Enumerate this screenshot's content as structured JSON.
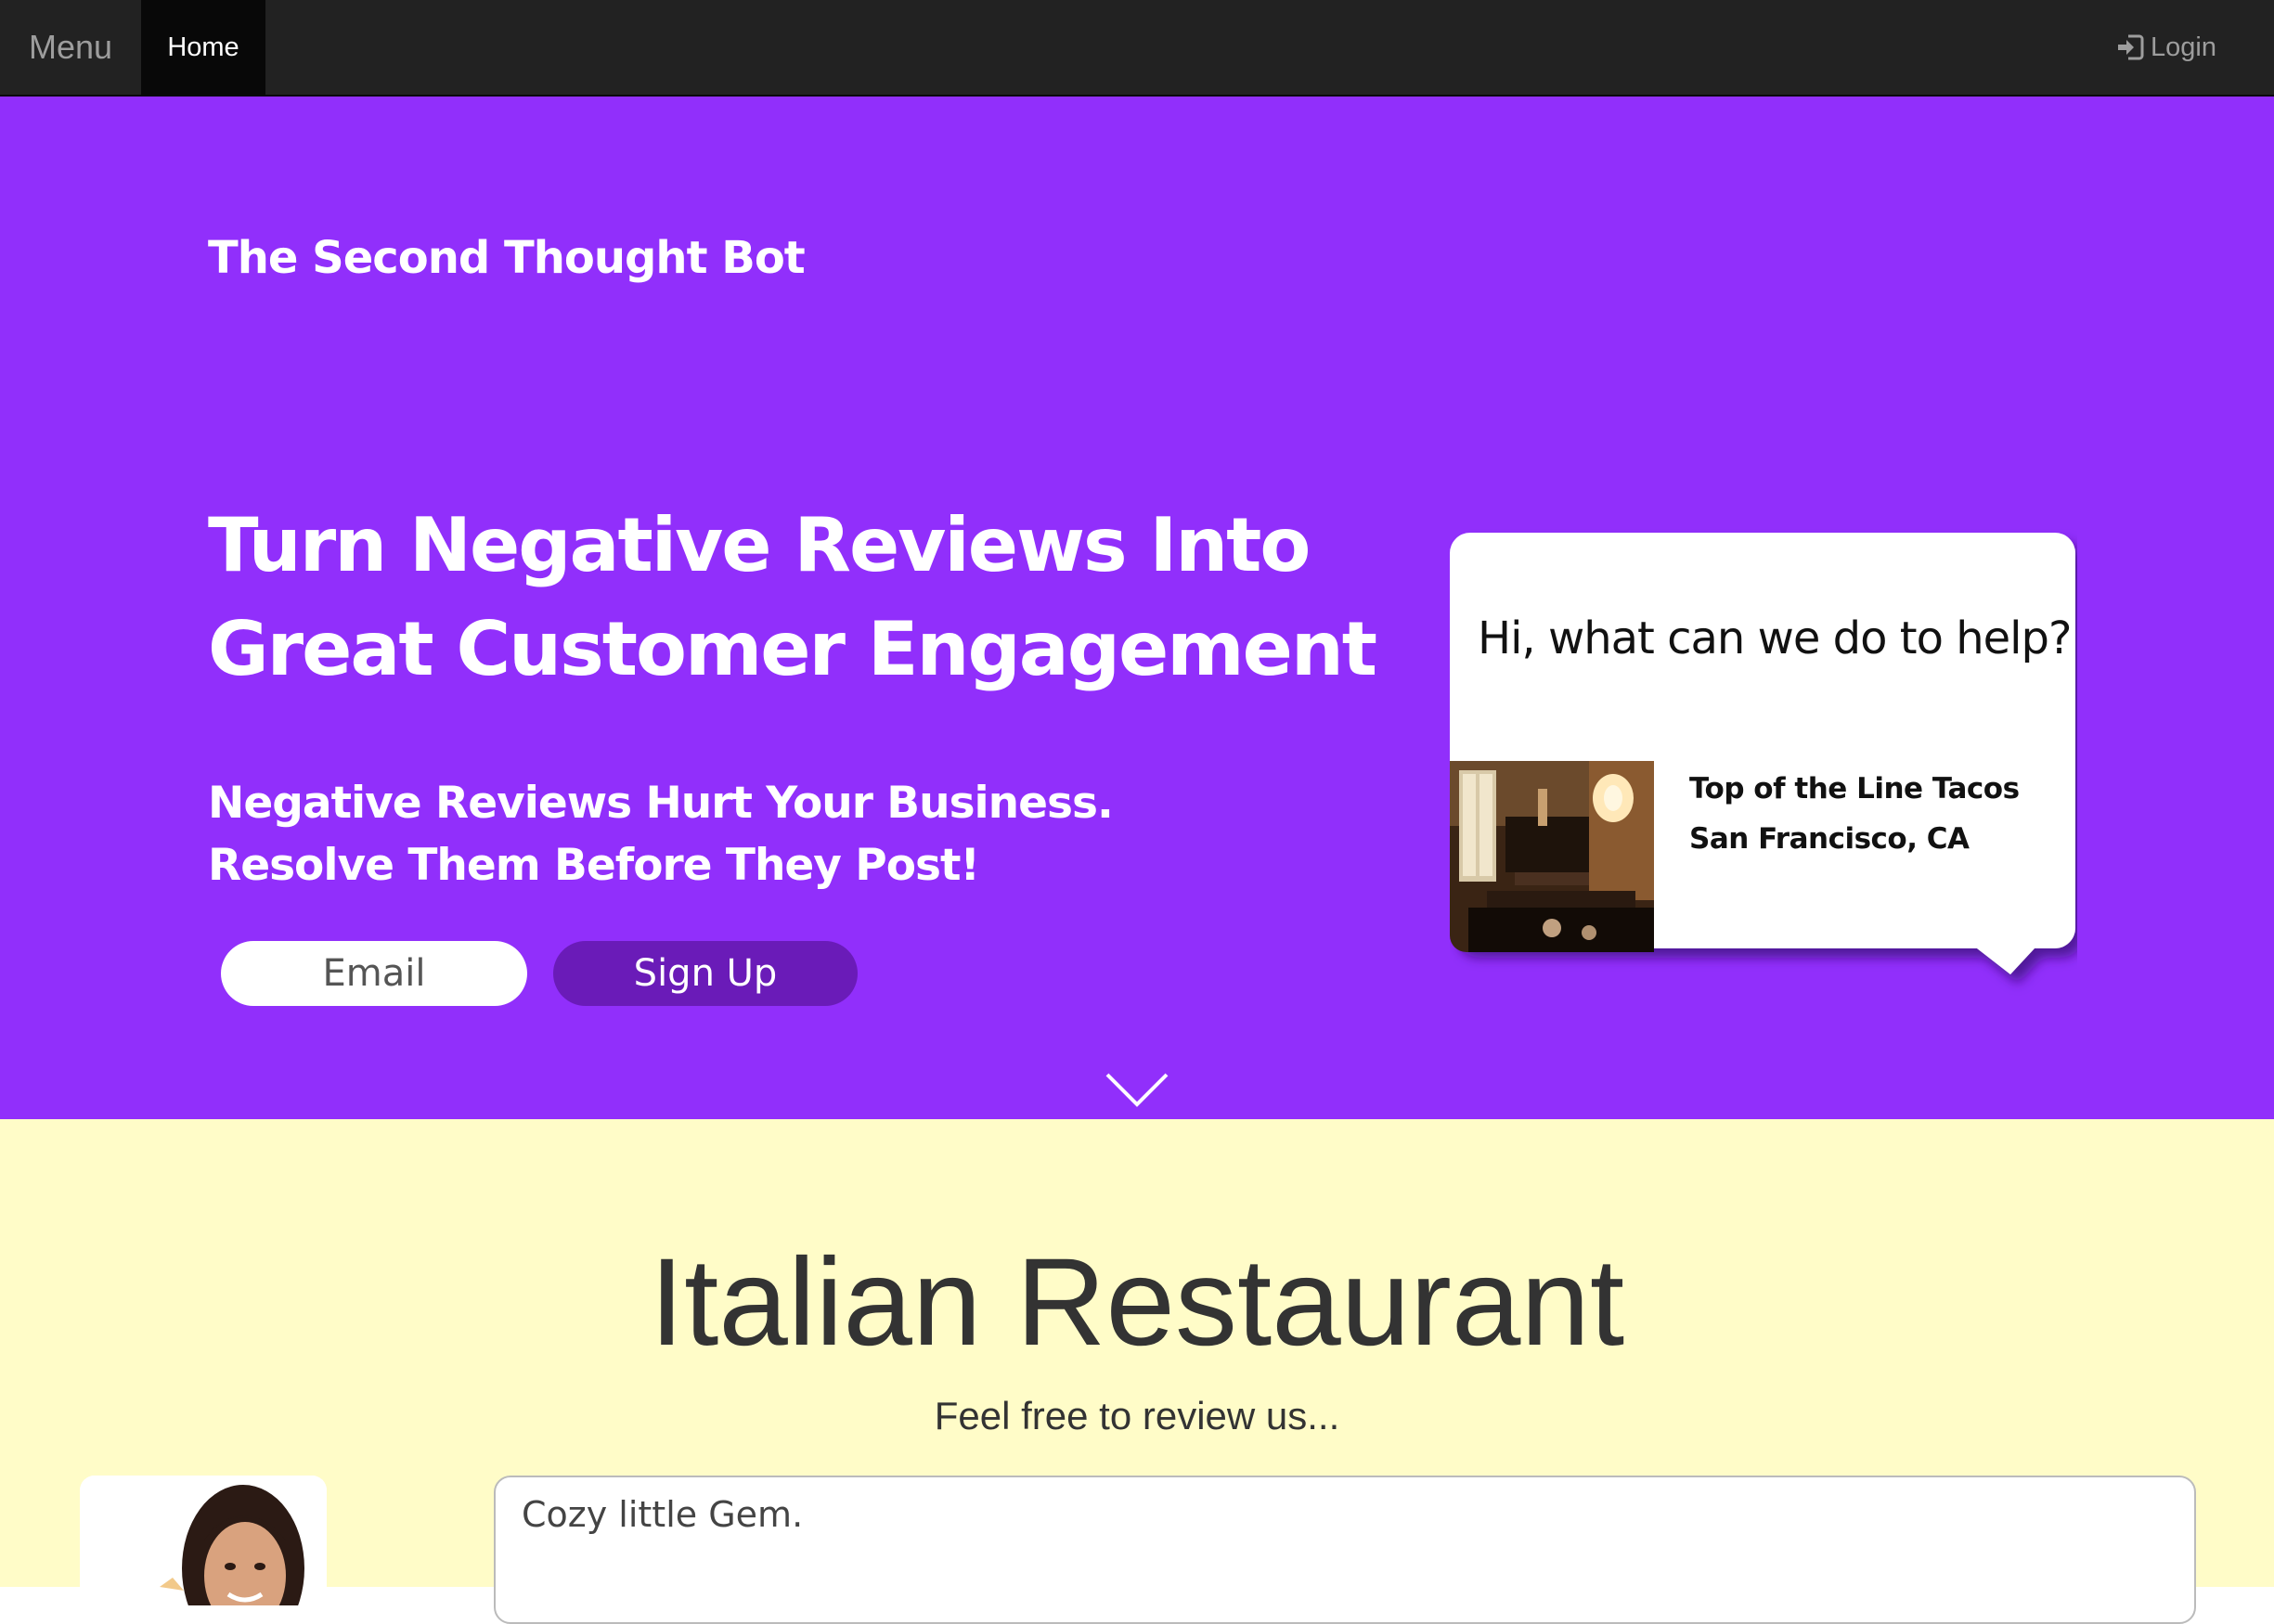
{
  "navbar": {
    "brand_label": "Menu",
    "home_label": "Home",
    "login_label": "Login",
    "login_icon": "sign-in-icon"
  },
  "hero": {
    "brand_title": "The Second Thought Bot",
    "headline_line1": "Turn Negative Reviews Into",
    "headline_line2": "Great Customer Engagement",
    "subhead_line1": "Negative Reviews Hurt Your Business.",
    "subhead_line2": "Resolve Them Before They Post!",
    "email_placeholder": "Email",
    "signup_label": "Sign Up",
    "scroll_icon": "chevron-down-icon",
    "background_color": "#912ffb",
    "signup_color": "#6a1bb8"
  },
  "bubble": {
    "question": "Hi, what can we do to help?",
    "business_name": "Top of the Line Tacos",
    "business_location": "San Francisco, CA"
  },
  "review": {
    "title": "Italian Restaurant",
    "prompt": "Feel free to review us...",
    "review_text": "Cozy little Gem.",
    "background_color": "#fffcc8"
  }
}
